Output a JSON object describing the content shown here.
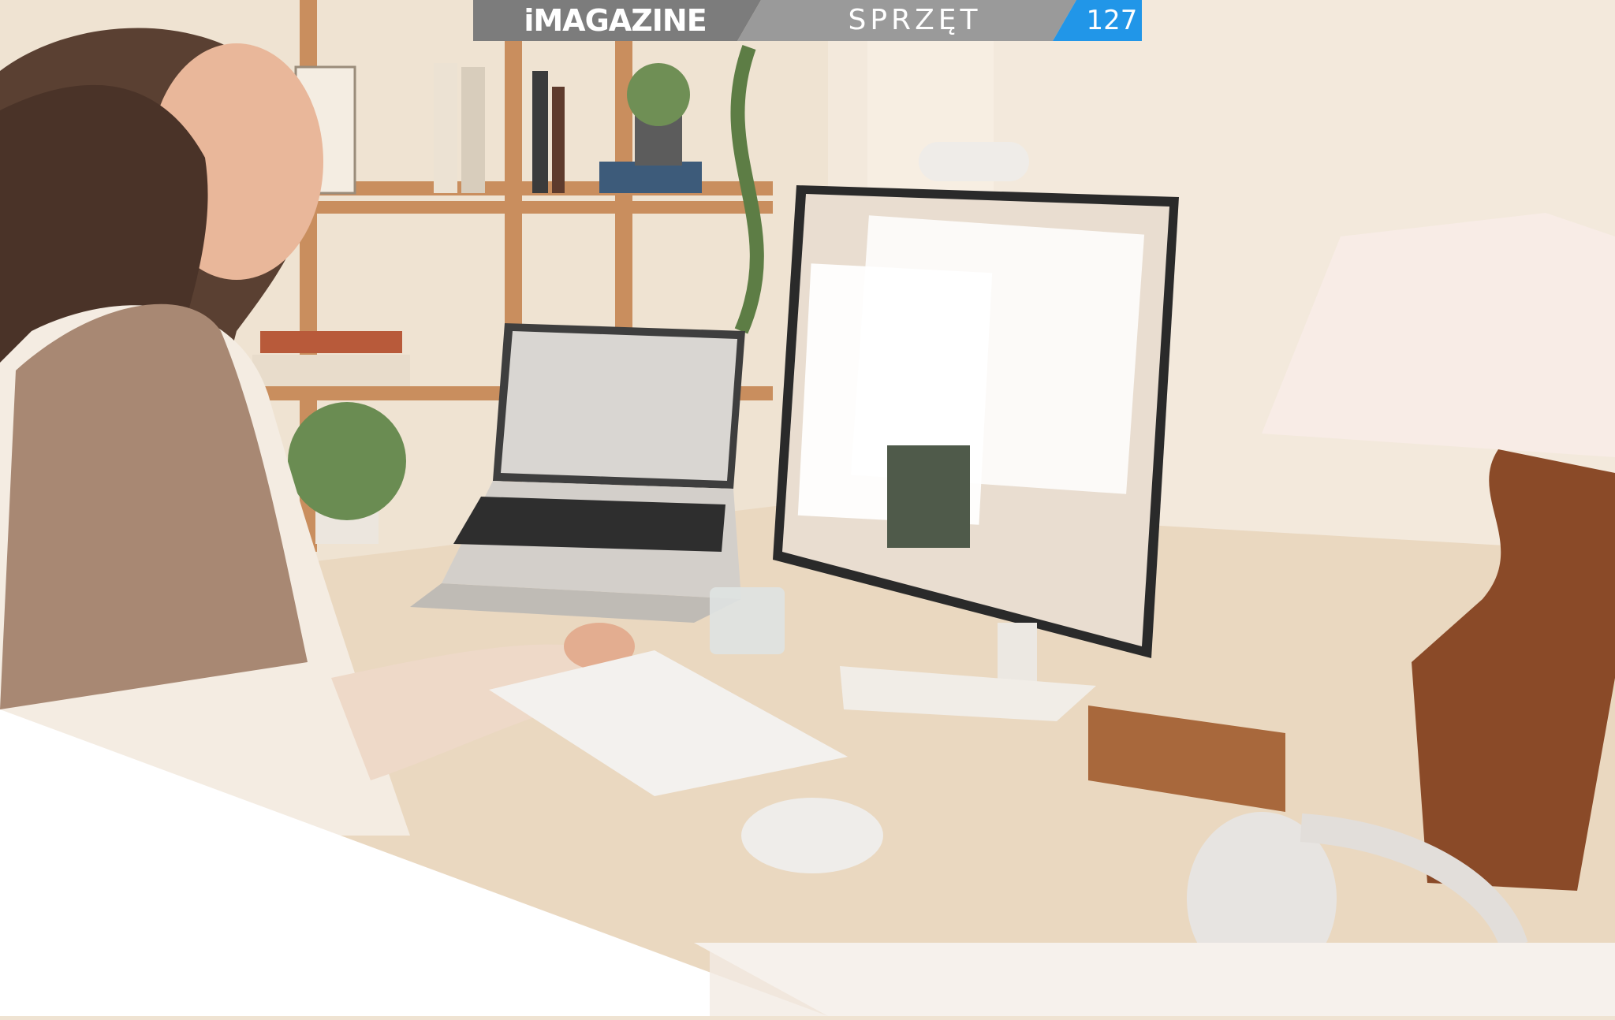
{
  "header": {
    "brand": "iMAGAZINE",
    "section": "SPRZĘT",
    "page_number": "127"
  },
  "photo": {
    "subject": "photo-home-office-desk"
  },
  "colors": {
    "bar_gray": "#7c7c7c",
    "bar_gray_light": "#9a9a9a",
    "bar_blue": "#2196e8",
    "wall": "#efe3d2",
    "desk": "#ead8c0",
    "paper": "#ffffff"
  }
}
